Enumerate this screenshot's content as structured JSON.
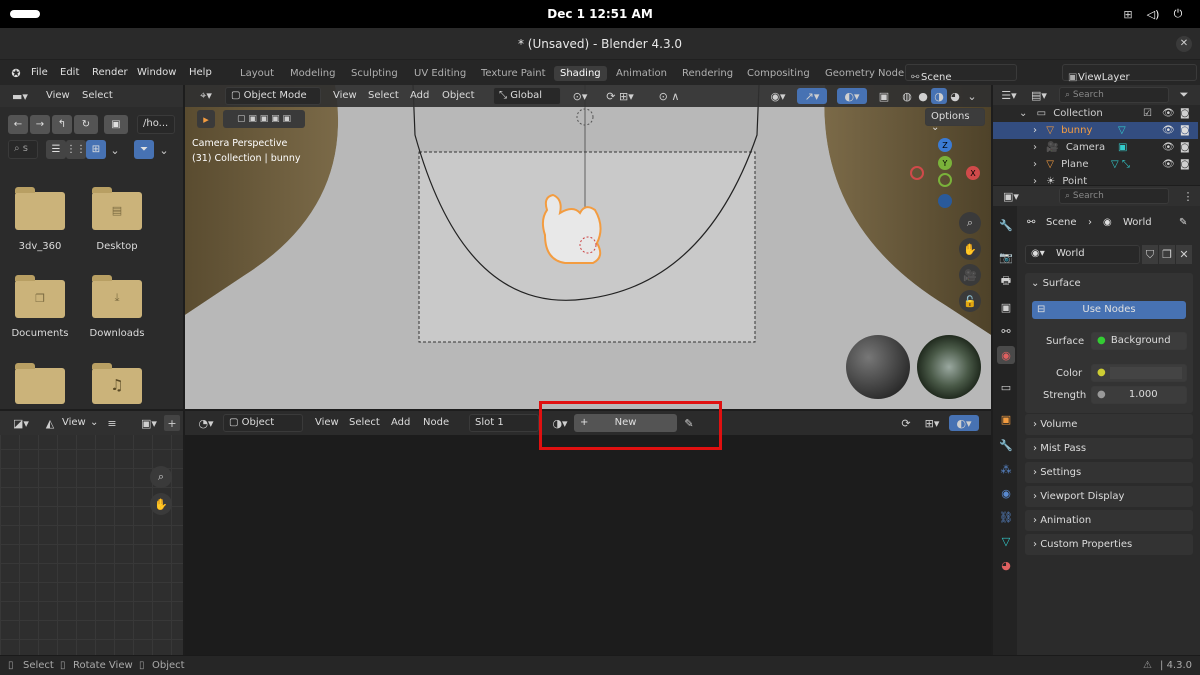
{
  "system": {
    "clock": "Dec 1  12:51 AM"
  },
  "window": {
    "title": "* (Unsaved) - Blender 4.3.0"
  },
  "menu": [
    "File",
    "Edit",
    "Render",
    "Window",
    "Help"
  ],
  "workspaces": [
    "Layout",
    "Modeling",
    "Sculpting",
    "UV Editing",
    "Texture Paint",
    "Shading",
    "Animation",
    "Rendering",
    "Compositing",
    "Geometry Node"
  ],
  "active_workspace": "Shading",
  "scene": {
    "name": "Scene",
    "view_layer": "ViewLayer"
  },
  "file_browser": {
    "view": "View",
    "select": "Select",
    "path": "/ho...",
    "items": [
      "3dv_360",
      "Desktop",
      "Documents",
      "Downloads"
    ]
  },
  "viewport": {
    "mode": "Object Mode",
    "view": "View",
    "select": "Select",
    "add": "Add",
    "object": "Object",
    "transform": "Global",
    "options": "Options",
    "camera_line1": "Camera Perspective",
    "camera_line2": "(31) Collection | bunny",
    "gizmo": {
      "z": "Z",
      "y": "Y",
      "x": "X"
    }
  },
  "image_editor": {
    "view": "View"
  },
  "node_editor": {
    "object": "Object",
    "view": "View",
    "select": "Select",
    "add": "Add",
    "node": "Node",
    "slot": "Slot 1",
    "new_label": "New"
  },
  "outliner": {
    "search_placeholder": "Search",
    "collection": "Collection",
    "items": [
      "bunny",
      "Camera",
      "Plane",
      "Point"
    ]
  },
  "properties": {
    "search_placeholder": "Search",
    "breadcrumb_scene": "Scene",
    "breadcrumb_world": "World",
    "world_name": "World",
    "surface_section": "Surface",
    "use_nodes": "Use Nodes",
    "surface_label": "Surface",
    "surface_value": "Background",
    "color_label": "Color",
    "strength_label": "Strength",
    "strength_value": "1.000",
    "sections": [
      "Volume",
      "Mist Pass",
      "Settings",
      "Viewport Display",
      "Animation",
      "Custom Properties"
    ]
  },
  "statusbar": {
    "select": "Select",
    "rotate": "Rotate View",
    "object": "Object",
    "version": "4.3.0"
  },
  "colors": {
    "accent": "#4772b3",
    "highlight_box": "#e01010",
    "selection": "#f39c40"
  }
}
